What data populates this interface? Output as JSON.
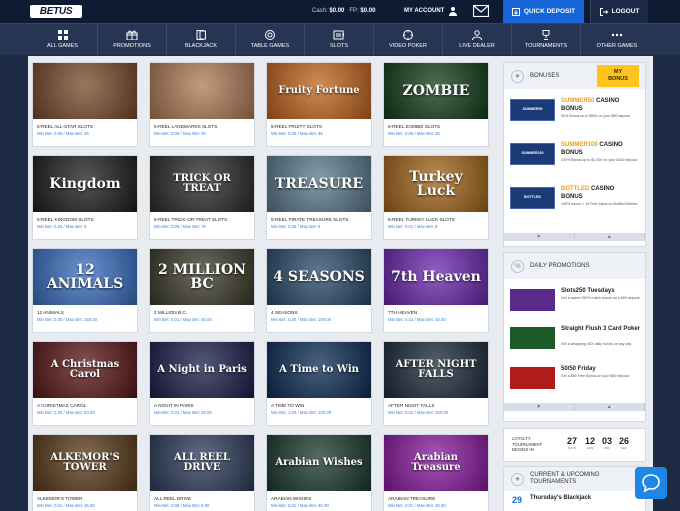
{
  "header": {
    "logo": "BETUS",
    "cash_label": "Cash:",
    "cash_value": "$0.00",
    "fp_label": "FP:",
    "fp_value": "$0.00",
    "my_account": "MY ACCOUNT",
    "quick_deposit": "QUICK DEPOSIT",
    "logout": "LOGOUT"
  },
  "nav": [
    {
      "label": "ALL GAMES",
      "icon": "grid-icon"
    },
    {
      "label": "PROMOTIONS",
      "icon": "gift-icon"
    },
    {
      "label": "BLACKJACK",
      "icon": "card-icon"
    },
    {
      "label": "TABLE GAMES",
      "icon": "chip-icon"
    },
    {
      "label": "SLOTS",
      "icon": "slot-machine-icon"
    },
    {
      "label": "VIDEO POKER",
      "icon": "poker-chip-icon"
    },
    {
      "label": "LIVE DEALER",
      "icon": "dealer-icon"
    },
    {
      "label": "TOURNAMENTS",
      "icon": "trophy-icon"
    },
    {
      "label": "OTHER GAMES",
      "icon": "dots-icon"
    }
  ],
  "games": [
    {
      "title": "5-REEL ALL-STAR SLOTS",
      "bets": "Min Bet: 0.05 / Max Bet: 45",
      "art": "",
      "bg": "#7a4a2a"
    },
    {
      "title": "5-REEL LANDMARKS SLOTS",
      "bets": "Min Bet: 0.05 / Max Bet: 45",
      "art": "",
      "bg": "#b07b55"
    },
    {
      "title": "5-REEL FRUITY SLOTS",
      "bets": "Min Bet: 0.05 / Max Bet: 45",
      "art": "Fruity Fortune",
      "bg": "#c2651d"
    },
    {
      "title": "5-REEL ZOMBIE SLOTS",
      "bets": "Min Bet: 0.05 / Max Bet: 45",
      "art": "ZOMBIE",
      "bg": "#123d1a"
    },
    {
      "title": "5-REEL KINGDOM SLOTS",
      "bets": "Min Bet: 0.25 / Max Bet: 9",
      "art": "Kingdom",
      "bg": "#1d1d1d"
    },
    {
      "title": "5-REEL TRICK-OR-TREAT SLOTS",
      "bets": "Min Bet: 0.05 / Max Bet: 76",
      "art": "TRICK OR TREAT",
      "bg": "#2a2a2a"
    },
    {
      "title": "5-REEL PIRATE TREASURE SLOTS",
      "bets": "Min Bet: 0.25 / Max Bet: 9",
      "art": "TREASURE",
      "bg": "#5a7a8c"
    },
    {
      "title": "5-REEL TURKEY LUCK SLOTS",
      "bets": "Min Bet: 0.01 / Max Bet: 9",
      "art": "Turkey Luck",
      "bg": "#a4651a"
    },
    {
      "title": "12 ANIMALS",
      "bets": "Min Bet: 0.30 / Max Bet: 150.00",
      "art": "12 ANIMALS",
      "bg": "#3a6fc2"
    },
    {
      "title": "2 MILLION B.C.",
      "bets": "Min Bet: 0.01 / Max Bet: 45.00",
      "art": "2 MILLION BC",
      "bg": "#3c3a2a"
    },
    {
      "title": "4 SEASONS",
      "bets": "Min Bet: 0.30 / Max Bet: 150.00",
      "art": "4 SEASONS",
      "bg": "#2a4a6a"
    },
    {
      "title": "7TH HEAVEN",
      "bets": "Min Bet: 0.01 / Max Bet: 45.00",
      "art": "7th Heaven",
      "bg": "#6a28b0"
    },
    {
      "title": "A CHRISTMAS CAROL",
      "bets": "Min Bet: 0.25 / Max Bet: 50.00",
      "art": "A Christmas Carol",
      "bg": "#5a1616"
    },
    {
      "title": "A NIGHT IN PARIS",
      "bets": "Min Bet: 0.01 / Max Bet: 45.00",
      "art": "A Night in Paris",
      "bg": "#1a1f4a"
    },
    {
      "title": "A TIME TO WIN",
      "bets": "Min Bet: 1.00 / Max Bet: 100.00",
      "art": "A Time to Win",
      "bg": "#0c2c55"
    },
    {
      "title": "AFTER NIGHT FALLS",
      "bets": "Min Bet: 0.01 / Max Bet: 150.00",
      "art": "AFTER NIGHT FALLS",
      "bg": "#1c2a3c"
    },
    {
      "title": "ALKEMOR'S TOWER",
      "bets": "Min Bet: 0.01 / Max Bet: 45.00",
      "art": "ALKEMOR'S TOWER",
      "bg": "#5a3a1a"
    },
    {
      "title": "ALL REEL DRIVE",
      "bets": "Min Bet: 0.08 / Max Bet: 8.00",
      "art": "ALL REEL DRIVE",
      "bg": "#2c3c5c"
    },
    {
      "title": "ARABIAN WISHES",
      "bets": "Min Bet: 0.01 / Max Bet: 45.00",
      "art": "Arabian Wishes",
      "bg": "#1a3a2c"
    },
    {
      "title": "ARABIAN TREASURE",
      "bets": "Min Bet: 0.01 / Max Bet: 45.00",
      "art": "Arabian Treasure",
      "bg": "#8a1aa0"
    }
  ],
  "bonuses": {
    "heading": "BONUSES",
    "my_bonus_1": "MY",
    "my_bonus_2": "BONUS",
    "items": [
      {
        "code": "SUMMER50",
        "rest": " CASINO",
        "line2": "BONUS",
        "desc": "50% Bonus up to $500 on your $50 deposit",
        "img": "SUMMER50"
      },
      {
        "code": "SUMMER100",
        "rest": " CASINO",
        "line2": "BONUS",
        "desc": "100% Bonus up to $1,000 on your $100 deposit",
        "img": "SUMMER100"
      },
      {
        "code": "BOTTLED",
        "rest": " CASINO",
        "line2": "BONUS",
        "desc": "100% bonus + 10 Free Spins on Bottled Wishes",
        "img": "BOTTLED"
      }
    ]
  },
  "promotions": {
    "heading": "DAILY PROMOTIONS",
    "items": [
      {
        "title": "Slots250 Tuesdays",
        "desc": "Get a sweet 250% match bonus on a $50 deposit",
        "color": "#5a2a8a"
      },
      {
        "title": "Straight Flush 3 Card Poker",
        "desc": "Get a whopping 40X daily bonus on any day",
        "color": "#1c5a2a"
      },
      {
        "title": "50/50 Friday",
        "desc": "Get a $50 Free Bonus on your $50 deposit",
        "color": "#b01c1c"
      }
    ]
  },
  "loyalty": {
    "l1": "LOYALTY",
    "l2": "TOURNAMENT",
    "l3": "BEGINS IN",
    "counters": [
      {
        "v": "27",
        "u": "DAYS"
      },
      {
        "v": "12",
        "u": "HRS"
      },
      {
        "v": "03",
        "u": "MIN"
      },
      {
        "v": "26",
        "u": "SEC"
      }
    ]
  },
  "tournaments": {
    "heading_1": "CURRENT & UPCOMING",
    "heading_2": "TOURNAMENTS",
    "first_day": "29",
    "first_title": "Thursday's Blackjack"
  },
  "colors": {
    "accent": "#1565d8",
    "bonus_highlight": "#f29d1a",
    "my_bonus": "#ffc31f",
    "bet_text": "#3d7fd1"
  }
}
